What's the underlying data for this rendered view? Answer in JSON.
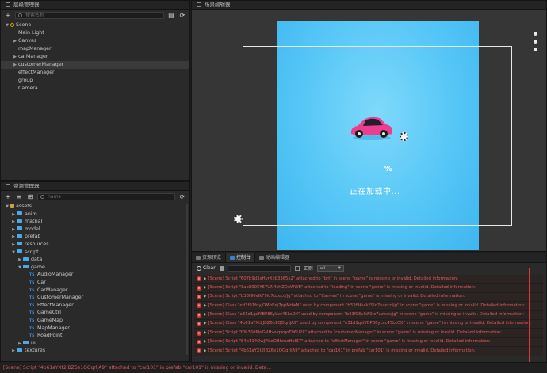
{
  "hierarchy": {
    "title": "层级管理器",
    "search_placeholder": "搜索名称",
    "nodes": [
      {
        "label": "Scene",
        "arrow": "▼",
        "indent": 0
      },
      {
        "label": "Main Light",
        "arrow": "",
        "indent": 1
      },
      {
        "label": "Canvas",
        "arrow": "▶",
        "indent": 1
      },
      {
        "label": "mapManager",
        "arrow": "",
        "indent": 1
      },
      {
        "label": "carManager",
        "arrow": "▶",
        "indent": 1
      },
      {
        "label": "customerManager",
        "arrow": "▶",
        "indent": 1,
        "selected": true
      },
      {
        "label": "effectManager",
        "arrow": "",
        "indent": 1
      },
      {
        "label": "group",
        "arrow": "",
        "indent": 1
      },
      {
        "label": "Camera",
        "arrow": "",
        "indent": 1
      }
    ]
  },
  "assets": {
    "title": "资源管理器",
    "search_placeholder": "name",
    "nodes": [
      {
        "label": "assets",
        "type": "db",
        "arrow": "▼",
        "indent": 0
      },
      {
        "label": "anim",
        "type": "folder",
        "arrow": "▶",
        "indent": 1
      },
      {
        "label": "matrial",
        "type": "folder",
        "arrow": "▶",
        "indent": 1
      },
      {
        "label": "model",
        "type": "folder",
        "arrow": "▶",
        "indent": 1
      },
      {
        "label": "prefab",
        "type": "folder",
        "arrow": "▶",
        "indent": 1
      },
      {
        "label": "resources",
        "type": "folder",
        "arrow": "▶",
        "indent": 1
      },
      {
        "label": "script",
        "type": "folder",
        "arrow": "▼",
        "indent": 1
      },
      {
        "label": "data",
        "type": "folder",
        "arrow": "▶",
        "indent": 2
      },
      {
        "label": "game",
        "type": "folder",
        "arrow": "▼",
        "indent": 2
      },
      {
        "label": "AudioManager",
        "type": "ts",
        "arrow": "",
        "indent": 3
      },
      {
        "label": "Car",
        "type": "ts",
        "arrow": "",
        "indent": 3
      },
      {
        "label": "CarManager",
        "type": "ts",
        "arrow": "",
        "indent": 3
      },
      {
        "label": "CustomerManager",
        "type": "ts",
        "arrow": "",
        "indent": 3
      },
      {
        "label": "EffectManager",
        "type": "ts",
        "arrow": "",
        "indent": 3
      },
      {
        "label": "GameCtrl",
        "type": "ts",
        "arrow": "",
        "indent": 3
      },
      {
        "label": "GameMap",
        "type": "ts",
        "arrow": "",
        "indent": 3
      },
      {
        "label": "MapManager",
        "type": "ts",
        "arrow": "",
        "indent": 3
      },
      {
        "label": "RoadPoint",
        "type": "ts",
        "arrow": "",
        "indent": 3
      },
      {
        "label": "ui",
        "type": "folder",
        "arrow": "▶",
        "indent": 2
      },
      {
        "label": "textures",
        "type": "folder",
        "arrow": "▶",
        "indent": 1
      }
    ]
  },
  "scene": {
    "title": "场景编辑器",
    "percent": "%",
    "loading_text": "正在加载中..."
  },
  "console": {
    "tabs": [
      "资源预览",
      "控制台",
      "动画编辑器"
    ],
    "active_tab": 1,
    "clear_label": "Clear",
    "regex_label": "正则",
    "level_value": "all",
    "logs": [
      "[Scene] Script \"607b9d3xHvrXJjb3365x2\" attached to \"brt\" in scene \"game\" is missing or invalid. Detailed information:",
      "[Scene] Script \"3ab8005Y5YUN4sHZDeWWE\" attached to \"loading\" in scene \"game\" is missing or invalid. Detailed information:",
      "[Scene] Script \"b33f96vlkF9lo7uzecc/jg\" attached to \"Canvas\" in scene \"game\" is missing or invalid. Detailed information:",
      "[Scene] Class \"ed3f91fdyJOMbEej7ppMdwN\" used by component \"b33f96vlkF9lo7uzecc/jg\" in scene \"game\" is missing or invalid. Detailed information:",
      "[Scene] Class \"e31d1qsfYBP86yLcc45LcOX\" used by component \"b33f96vlkF9lo7uzecc/jg\" in scene \"game\" is missing or invalid. Detailed information:",
      "[Scene] Class \"4b61aYXt2JBZ6e1QOqrljA9\" used by component \"e31d1qsfYBP86yLcc45LcOX\" in scene \"game\" is missing or invalid. Detailed information:",
      "[Scene] Script \"f0b36dMeGNHwvqwqoT96U2L\" attached to \"customerManager\" in scene \"game\" is missing or invalid. Detailed information:",
      "[Scene] Script \"84b114OwJPlsoOBhmeHxf37\" attached to \"effectManager\" in scene \"game\" is missing or invalid. Detailed information:",
      "[Scene] Script \"4b61aYXt2JBZ6e1QOqrljA9\" attached to \"car101\" in prefab \"car101\" is missing or invalid. Detailed information:"
    ]
  },
  "status_bar": {
    "text": "[Scene] Script \"4b61aYXt2JBZ6e1QOqrljA9\" attached to \"car101\" in prefab \"car101\" is missing or invalid. Deta..."
  },
  "colors": {
    "error": "#e25c5c",
    "highlight_box": "#d33b3b",
    "accent": "#3a80d2",
    "folder": "#4aa8e6",
    "car": "#ec3d8f"
  }
}
